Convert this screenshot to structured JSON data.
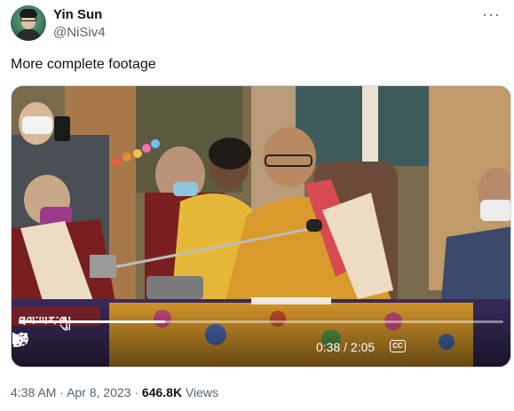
{
  "author": {
    "name": "Yin Sun",
    "handle": "@NiSiv4",
    "avatar_icon": "profile-avatar"
  },
  "more_icon": "more-horizontal-icon",
  "more_label": "···",
  "tweet": {
    "text": "More complete footage"
  },
  "video": {
    "caption_overlay": "ཐལ་ཡར་ཞུ།",
    "current_time": "0:38",
    "separator": "/",
    "duration": "2:05",
    "progress_fraction": 0.303,
    "cc_label": "CC",
    "icons": [
      "play-icon",
      "captions-icon",
      "volume-icon",
      "settings-gear-icon",
      "fullscreen-icon"
    ]
  },
  "meta": {
    "time": "4:38 AM",
    "dot1": "·",
    "date": "Apr 8, 2023",
    "dot2": "·",
    "views_count": "646.8K",
    "views_label": "Views"
  },
  "colors": {
    "text_primary": "#0f1419",
    "text_secondary": "#536471",
    "robe_orange": "#d99a2b",
    "robe_maroon": "#7a1f1f"
  }
}
